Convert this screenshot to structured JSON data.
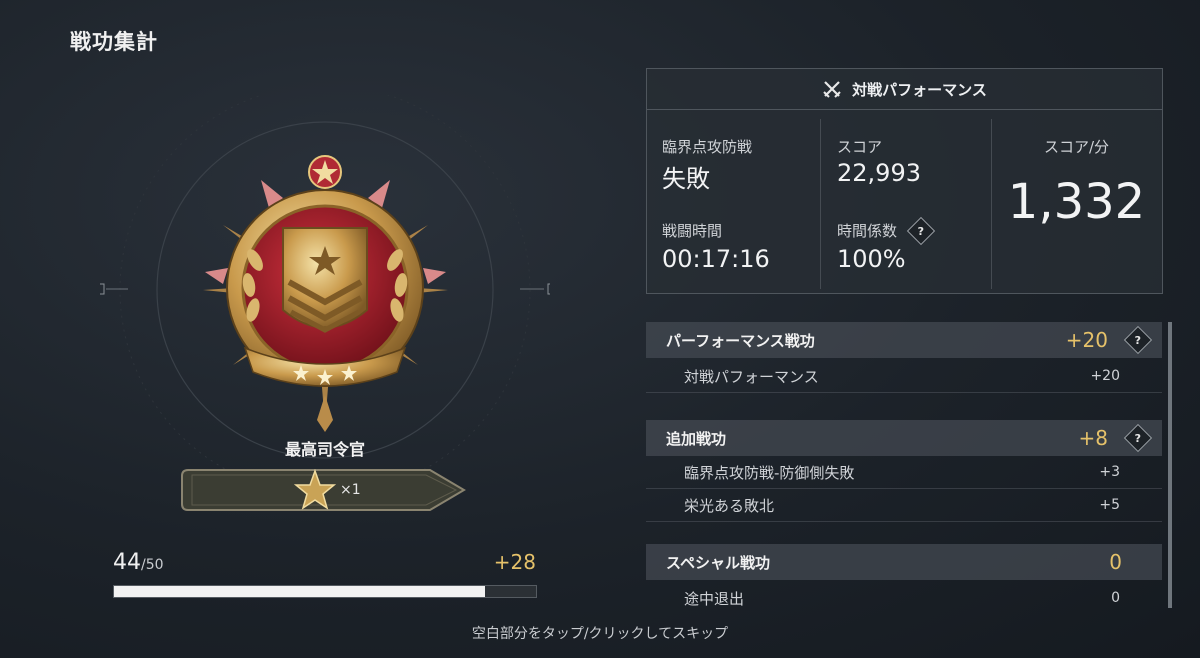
{
  "page_title": "戦功集計",
  "rank": {
    "name": "最高司令官",
    "stars": "×1"
  },
  "progress": {
    "current": "44",
    "max": "/50",
    "gain": "+28",
    "fraction": 0.88
  },
  "stats": {
    "header": "対戦パフォーマンス",
    "mode_label": "臨界点攻防戦",
    "mode_value": "失敗",
    "score_label": "スコア",
    "score_value": "22,993",
    "time_label": "戦闘時間",
    "time_value": "00:17:16",
    "factor_label": "時間係数",
    "factor_value": "100%",
    "spm_label": "スコア/分",
    "spm_value": "1,332"
  },
  "merits": [
    {
      "title": "パーフォーマンス戦功",
      "value": "+20",
      "items": [
        {
          "label": "対戦パフォーマンス",
          "value": "+20"
        }
      ]
    },
    {
      "title": "追加戦功",
      "value": "+8",
      "items": [
        {
          "label": "臨界点攻防戦-防御側失敗",
          "value": "+3"
        },
        {
          "label": "栄光ある敗北",
          "value": "+5"
        }
      ]
    },
    {
      "title": "スペシャル戦功",
      "value": "0",
      "items": [
        {
          "label": "途中退出",
          "value": "0"
        }
      ]
    }
  ],
  "help_glyph": "?",
  "skip_hint": "空白部分をタップ/クリックしてスキップ",
  "colors": {
    "accent_gold": "#e6c26a",
    "panel_bg": "#282e35"
  }
}
